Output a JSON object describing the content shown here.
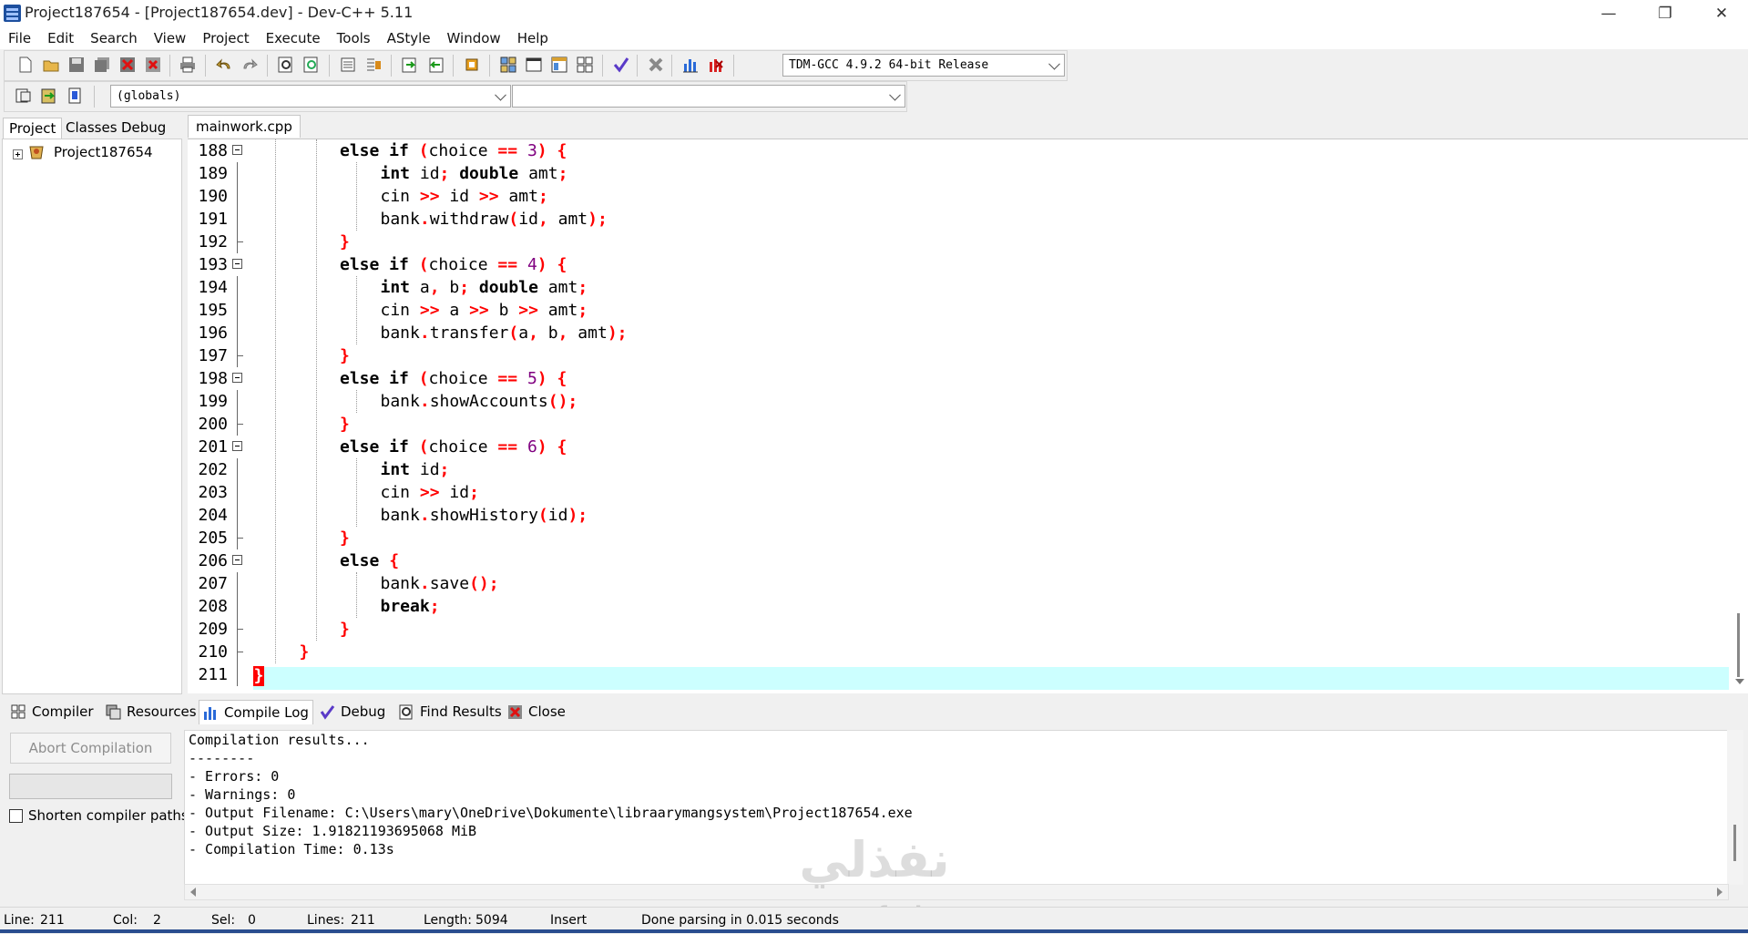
{
  "window": {
    "title": "Project187654 - [Project187654.dev] - Dev-C++ 5.11"
  },
  "menu": [
    "File",
    "Edit",
    "Search",
    "View",
    "Project",
    "Execute",
    "Tools",
    "AStyle",
    "Window",
    "Help"
  ],
  "toolbar": {
    "compiler_select": "TDM-GCC 4.9.2 64-bit Release",
    "scope_select": "(globals)",
    "function_select": ""
  },
  "left_panel": {
    "tabs": [
      "Project",
      "Classes",
      "Debug"
    ],
    "project_node": "Project187654"
  },
  "editor": {
    "file_tab": "mainwork.cpp",
    "lines": [
      {
        "n": "188",
        "tokens": [
          [
            "kw",
            "else if"
          ],
          [
            "t",
            " "
          ],
          [
            "sym",
            "("
          ],
          [
            "t",
            "choice "
          ],
          [
            "sym",
            "=="
          ],
          [
            "t",
            " "
          ],
          [
            "num",
            "3"
          ],
          [
            "sym",
            ")"
          ],
          [
            "t",
            " "
          ],
          [
            "sym",
            "{"
          ]
        ]
      },
      {
        "n": "189",
        "tokens": [
          [
            "kw",
            "int"
          ],
          [
            "t",
            " id"
          ],
          [
            "sym",
            ";"
          ],
          [
            "t",
            " "
          ],
          [
            "kw",
            "double"
          ],
          [
            "t",
            " amt"
          ],
          [
            "sym",
            ";"
          ]
        ]
      },
      {
        "n": "190",
        "tokens": [
          [
            "t",
            "cin "
          ],
          [
            "sym",
            ">>"
          ],
          [
            "t",
            " id "
          ],
          [
            "sym",
            ">>"
          ],
          [
            "t",
            " amt"
          ],
          [
            "sym",
            ";"
          ]
        ]
      },
      {
        "n": "191",
        "tokens": [
          [
            "t",
            "bank"
          ],
          [
            "sym",
            "."
          ],
          [
            "t",
            "withdraw"
          ],
          [
            "sym",
            "("
          ],
          [
            "t",
            "id"
          ],
          [
            "sym",
            ","
          ],
          [
            "t",
            " amt"
          ],
          [
            "sym",
            ");"
          ]
        ]
      },
      {
        "n": "192",
        "tokens": [
          [
            "sym",
            "}"
          ]
        ]
      },
      {
        "n": "193",
        "tokens": [
          [
            "kw",
            "else if"
          ],
          [
            "t",
            " "
          ],
          [
            "sym",
            "("
          ],
          [
            "t",
            "choice "
          ],
          [
            "sym",
            "=="
          ],
          [
            "t",
            " "
          ],
          [
            "num",
            "4"
          ],
          [
            "sym",
            ")"
          ],
          [
            "t",
            " "
          ],
          [
            "sym",
            "{"
          ]
        ]
      },
      {
        "n": "194",
        "tokens": [
          [
            "kw",
            "int"
          ],
          [
            "t",
            " a"
          ],
          [
            "sym",
            ","
          ],
          [
            "t",
            " b"
          ],
          [
            "sym",
            ";"
          ],
          [
            "t",
            " "
          ],
          [
            "kw",
            "double"
          ],
          [
            "t",
            " amt"
          ],
          [
            "sym",
            ";"
          ]
        ]
      },
      {
        "n": "195",
        "tokens": [
          [
            "t",
            "cin "
          ],
          [
            "sym",
            ">>"
          ],
          [
            "t",
            " a "
          ],
          [
            "sym",
            ">>"
          ],
          [
            "t",
            " b "
          ],
          [
            "sym",
            ">>"
          ],
          [
            "t",
            " amt"
          ],
          [
            "sym",
            ";"
          ]
        ]
      },
      {
        "n": "196",
        "tokens": [
          [
            "t",
            "bank"
          ],
          [
            "sym",
            "."
          ],
          [
            "t",
            "transfer"
          ],
          [
            "sym",
            "("
          ],
          [
            "t",
            "a"
          ],
          [
            "sym",
            ","
          ],
          [
            "t",
            " b"
          ],
          [
            "sym",
            ","
          ],
          [
            "t",
            " amt"
          ],
          [
            "sym",
            ");"
          ]
        ]
      },
      {
        "n": "197",
        "tokens": [
          [
            "sym",
            "}"
          ]
        ]
      },
      {
        "n": "198",
        "tokens": [
          [
            "kw",
            "else if"
          ],
          [
            "t",
            " "
          ],
          [
            "sym",
            "("
          ],
          [
            "t",
            "choice "
          ],
          [
            "sym",
            "=="
          ],
          [
            "t",
            " "
          ],
          [
            "num",
            "5"
          ],
          [
            "sym",
            ")"
          ],
          [
            "t",
            " "
          ],
          [
            "sym",
            "{"
          ]
        ]
      },
      {
        "n": "199",
        "tokens": [
          [
            "t",
            "bank"
          ],
          [
            "sym",
            "."
          ],
          [
            "t",
            "showAccounts"
          ],
          [
            "sym",
            "();"
          ]
        ]
      },
      {
        "n": "200",
        "tokens": [
          [
            "sym",
            "}"
          ]
        ]
      },
      {
        "n": "201",
        "tokens": [
          [
            "kw",
            "else if"
          ],
          [
            "t",
            " "
          ],
          [
            "sym",
            "("
          ],
          [
            "t",
            "choice "
          ],
          [
            "sym",
            "=="
          ],
          [
            "t",
            " "
          ],
          [
            "num",
            "6"
          ],
          [
            "sym",
            ")"
          ],
          [
            "t",
            " "
          ],
          [
            "sym",
            "{"
          ]
        ]
      },
      {
        "n": "202",
        "tokens": [
          [
            "kw",
            "int"
          ],
          [
            "t",
            " id"
          ],
          [
            "sym",
            ";"
          ]
        ]
      },
      {
        "n": "203",
        "tokens": [
          [
            "t",
            "cin "
          ],
          [
            "sym",
            ">>"
          ],
          [
            "t",
            " id"
          ],
          [
            "sym",
            ";"
          ]
        ]
      },
      {
        "n": "204",
        "tokens": [
          [
            "t",
            "bank"
          ],
          [
            "sym",
            "."
          ],
          [
            "t",
            "showHistory"
          ],
          [
            "sym",
            "("
          ],
          [
            "t",
            "id"
          ],
          [
            "sym",
            ");"
          ]
        ]
      },
      {
        "n": "205",
        "tokens": [
          [
            "sym",
            "}"
          ]
        ]
      },
      {
        "n": "206",
        "tokens": [
          [
            "kw",
            "else"
          ],
          [
            "t",
            " "
          ],
          [
            "sym",
            "{"
          ]
        ]
      },
      {
        "n": "207",
        "tokens": [
          [
            "t",
            "bank"
          ],
          [
            "sym",
            "."
          ],
          [
            "t",
            "save"
          ],
          [
            "sym",
            "();"
          ]
        ]
      },
      {
        "n": "208",
        "tokens": [
          [
            "kw",
            "break"
          ],
          [
            "sym",
            ";"
          ]
        ]
      },
      {
        "n": "209",
        "tokens": [
          [
            "sym",
            "}"
          ]
        ]
      },
      {
        "n": "210",
        "tokens": [
          [
            "sym",
            "}"
          ]
        ]
      },
      {
        "n": "211",
        "tokens": [
          [
            "brace",
            "}"
          ]
        ]
      }
    ]
  },
  "bottom_tabs": [
    "Compiler",
    "Resources",
    "Compile Log",
    "Debug",
    "Find Results",
    "Close"
  ],
  "compile": {
    "abort_label": "Abort Compilation",
    "shorten_label": "Shorten compiler paths",
    "log": [
      "Compilation results...",
      "--------",
      "- Errors: 0",
      "- Warnings: 0",
      "- Output Filename: C:\\Users\\mary\\OneDrive\\Dokumente\\libraarymangsystem\\Project187654.exe",
      "- Output Size: 1.91821193695068 MiB",
      "- Compilation Time: 0.13s"
    ]
  },
  "status": {
    "line_label": "Line:",
    "line": "211",
    "col_label": "Col:",
    "col": "2",
    "sel_label": "Sel:",
    "sel": "0",
    "lines_label": "Lines:",
    "lines": "211",
    "length_label": "Length:",
    "length": "5094",
    "mode": "Insert",
    "message": "Done parsing in 0.015 seconds"
  },
  "watermark": {
    "arabic": "نفذلي",
    "latin": "nafezly.com"
  },
  "colors": {
    "keyword": "#000000",
    "symbol": "#ff0000",
    "number": "#800080",
    "current_line": "#ccffff"
  }
}
